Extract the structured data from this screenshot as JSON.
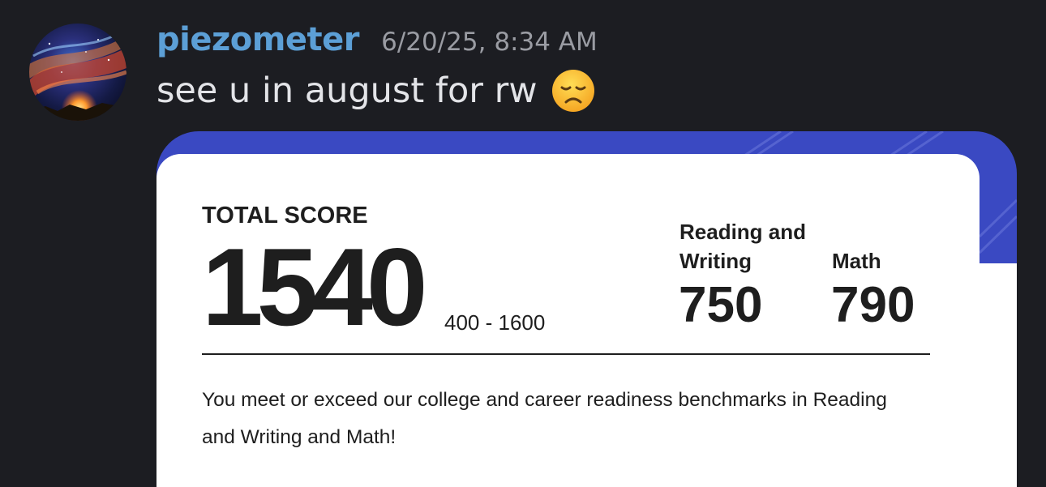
{
  "message": {
    "username": "piezometer",
    "timestamp": "6/20/25, 8:34 AM",
    "text": "see u in august for rw",
    "emoji_icon": "disappointed-face-icon"
  },
  "score_card": {
    "total_label": "TOTAL SCORE",
    "total_score": "1540",
    "score_range": "400 - 1600",
    "sections": [
      {
        "label": "Reading and Writing",
        "score": "750"
      },
      {
        "label": "Math",
        "score": "790"
      }
    ],
    "benchmark_text": "You meet or exceed our college and career readiness benchmarks in Reading and Writing and Math!"
  },
  "colors": {
    "username": "#5c9fd6",
    "background": "#1c1d22",
    "card_accent": "#3a49c2",
    "card": "#ffffff"
  }
}
